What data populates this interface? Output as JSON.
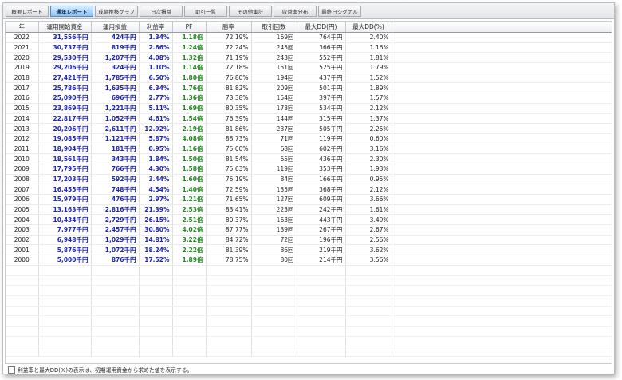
{
  "tabs": [
    {
      "label": "概要レポート",
      "active": false
    },
    {
      "label": "通年レポート",
      "active": true
    },
    {
      "label": "成績推移グラフ",
      "active": false
    },
    {
      "label": "日次損益",
      "active": false
    },
    {
      "label": "取引一覧",
      "active": false
    },
    {
      "label": "その他集計",
      "active": false
    },
    {
      "label": "収益率分布",
      "active": false
    },
    {
      "label": "最終日シグナル",
      "active": false
    }
  ],
  "columns": [
    "年",
    "運用開始資金",
    "運用損益",
    "利益率",
    "PF",
    "勝率",
    "取引回数",
    "最大DD(円)",
    "最大DD(%)"
  ],
  "rows": [
    [
      "2022",
      "31,556千円",
      "424千円",
      "1.34%",
      "1.18倍",
      "72.19%",
      "169回",
      "764千円",
      "2.40%"
    ],
    [
      "2021",
      "30,737千円",
      "819千円",
      "2.66%",
      "1.24倍",
      "72.24%",
      "245回",
      "366千円",
      "1.16%"
    ],
    [
      "2020",
      "29,530千円",
      "1,207千円",
      "4.08%",
      "1.32倍",
      "71.19%",
      "243回",
      "552千円",
      "1.81%"
    ],
    [
      "2019",
      "29,206千円",
      "324千円",
      "1.10%",
      "1.14倍",
      "72.18%",
      "151回",
      "525千円",
      "1.79%"
    ],
    [
      "2018",
      "27,421千円",
      "1,785千円",
      "6.50%",
      "1.80倍",
      "76.80%",
      "194回",
      "437千円",
      "1.52%"
    ],
    [
      "2017",
      "25,786千円",
      "1,635千円",
      "6.34%",
      "1.76倍",
      "81.82%",
      "209回",
      "501千円",
      "1.89%"
    ],
    [
      "2016",
      "25,090千円",
      "696千円",
      "2.77%",
      "1.36倍",
      "73.38%",
      "154回",
      "397千円",
      "1.57%"
    ],
    [
      "2015",
      "23,869千円",
      "1,221千円",
      "5.11%",
      "1.69倍",
      "80.35%",
      "173回",
      "534千円",
      "2.12%"
    ],
    [
      "2014",
      "22,817千円",
      "1,052千円",
      "4.61%",
      "1.54倍",
      "76.39%",
      "144回",
      "315千円",
      "1.37%"
    ],
    [
      "2013",
      "20,206千円",
      "2,611千円",
      "12.92%",
      "2.19倍",
      "81.86%",
      "237回",
      "505千円",
      "2.25%"
    ],
    [
      "2012",
      "19,085千円",
      "1,121千円",
      "5.87%",
      "4.08倍",
      "88.73%",
      "71回",
      "119千円",
      "0.60%"
    ],
    [
      "2011",
      "18,904千円",
      "181千円",
      "0.95%",
      "1.16倍",
      "75.00%",
      "68回",
      "602千円",
      "3.16%"
    ],
    [
      "2010",
      "18,561千円",
      "343千円",
      "1.84%",
      "1.50倍",
      "81.54%",
      "65回",
      "436千円",
      "2.30%"
    ],
    [
      "2009",
      "17,795千円",
      "766千円",
      "4.30%",
      "1.58倍",
      "75.63%",
      "119回",
      "353千円",
      "1.93%"
    ],
    [
      "2008",
      "17,203千円",
      "592千円",
      "3.44%",
      "1.60倍",
      "76.19%",
      "84回",
      "166千円",
      "0.95%"
    ],
    [
      "2007",
      "16,455千円",
      "748千円",
      "4.54%",
      "1.40倍",
      "72.59%",
      "135回",
      "368千円",
      "2.12%"
    ],
    [
      "2006",
      "15,979千円",
      "476千円",
      "2.97%",
      "1.21倍",
      "71.65%",
      "127回",
      "609千円",
      "3.66%"
    ],
    [
      "2005",
      "13,163千円",
      "2,816千円",
      "21.39%",
      "2.53倍",
      "83.41%",
      "223回",
      "242千円",
      "1.61%"
    ],
    [
      "2004",
      "10,434千円",
      "2,729千円",
      "26.15%",
      "2.51倍",
      "80.37%",
      "163回",
      "443千円",
      "3.49%"
    ],
    [
      "2003",
      "7,977千円",
      "2,457千円",
      "30.80%",
      "4.02倍",
      "87.77%",
      "139回",
      "267千円",
      "2.67%"
    ],
    [
      "2002",
      "6,948千円",
      "1,029千円",
      "14.81%",
      "3.22倍",
      "84.72%",
      "72回",
      "196千円",
      "2.56%"
    ],
    [
      "2001",
      "5,876千円",
      "1,072千円",
      "18.24%",
      "2.22倍",
      "81.39%",
      "86回",
      "219千円",
      "3.62%"
    ],
    [
      "2000",
      "5,000千円",
      "876千円",
      "17.52%",
      "1.89倍",
      "78.75%",
      "80回",
      "214千円",
      "3.56%"
    ]
  ],
  "footer": {
    "checkbox_label": "利益率と最大DD(%)の表示は、初期運用資金から求めた値を表示する。",
    "checked": false
  },
  "colors": {
    "value_blue": "#1d24b8",
    "pf_green": "#1e8a1e",
    "active_tab": "#8cc2f2"
  }
}
